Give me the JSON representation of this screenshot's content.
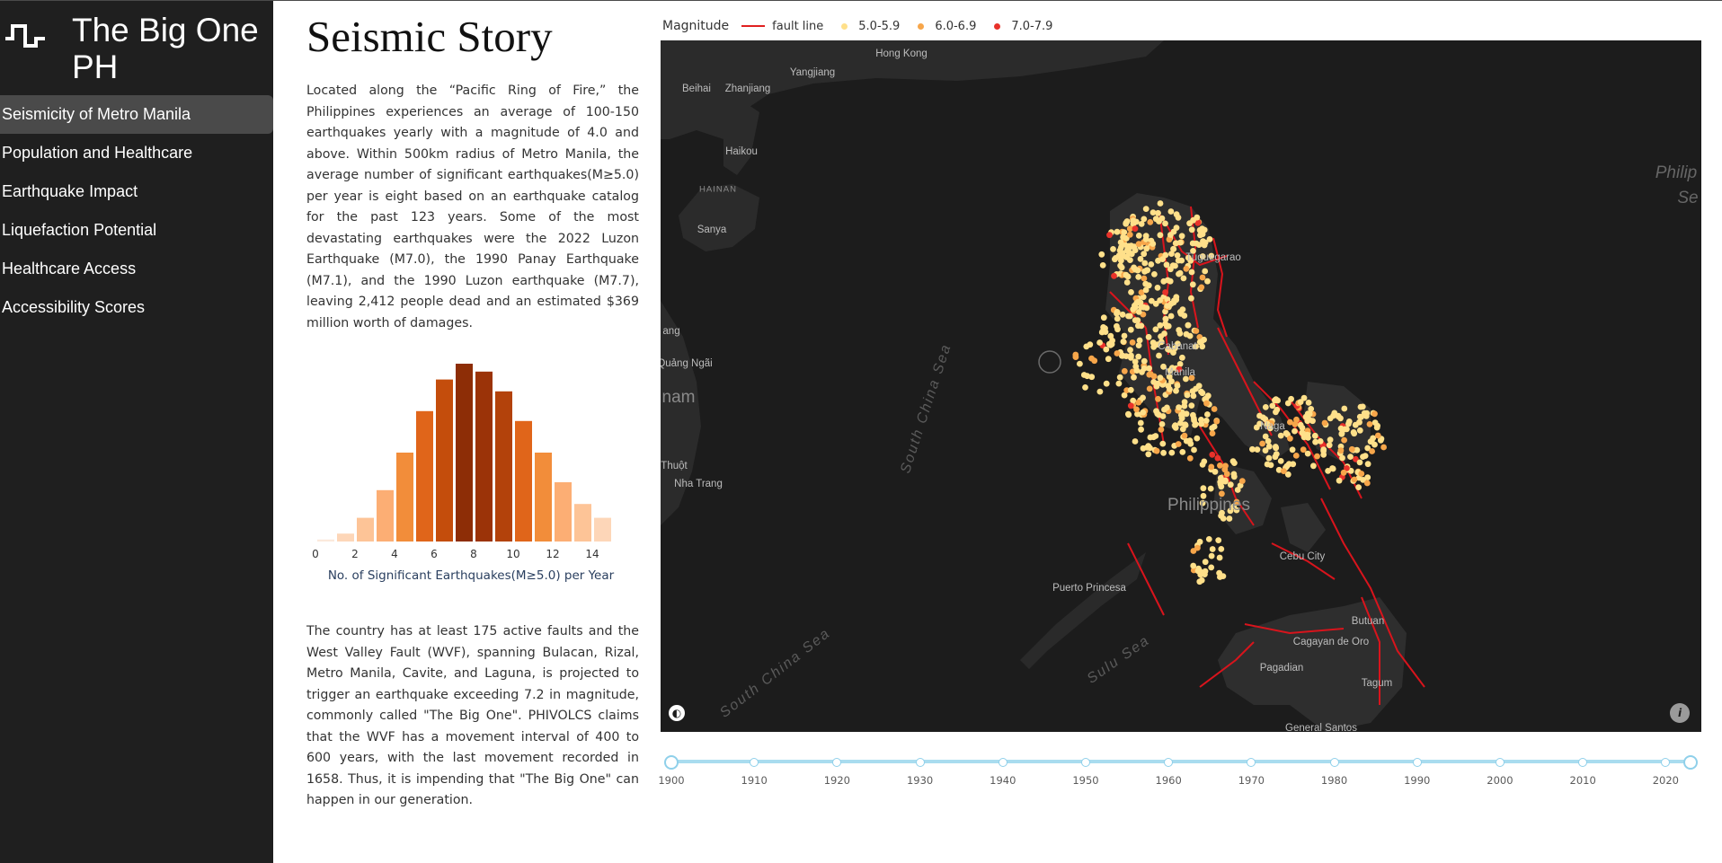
{
  "app": {
    "title": "The Big One PH",
    "nav": [
      {
        "label": "Seismicity of Metro Manila",
        "active": true
      },
      {
        "label": "Population and Healthcare"
      },
      {
        "label": "Earthquake Impact"
      },
      {
        "label": "Liquefaction Potential"
      },
      {
        "label": "Healthcare Access"
      },
      {
        "label": "Accessibility Scores"
      }
    ]
  },
  "story": {
    "title": "Seismic Story",
    "paragraph1": "Located along the “Pacific Ring of Fire,” the Philippines experiences an average of 100-150 earthquakes yearly with a magnitude of 4.0 and above. Within 500km radius of Metro Manila, the average number of significant earthquakes(M≥5.0) per year is eight based on an earthquake catalog for the past 123 years. Some of the most devastating earthquakes were the 2022 Luzon Earthquake (M7.0), the 1990 Panay Earthquake (M7.1), and the 1990 Luzon earthquake (M7.7), leaving 2,412 people dead and an estimated $369 million worth of damages.",
    "paragraph2": "The country has at least 175 active faults and the West Valley Fault (WVF), spanning Bulacan, Rizal, Metro Manila, Cavite, and Laguna, is projected to trigger an earthquake exceeding 7.2 in magnitude, commonly called \"The Big One\". PHIVOLCS claims that the WVF has a movement interval of 400 to 600 years, with the last movement recorded in 1658. Thus, it is impending that \"The Big One\" can happen in our generation."
  },
  "chart_data": {
    "type": "bar",
    "xlabel": "No. of Significant Earthquakes(M≥5.0) per Year",
    "x_ticks": [
      0,
      2,
      4,
      6,
      8,
      10,
      12,
      14
    ],
    "bins": [
      1,
      2,
      3,
      4,
      5,
      6,
      7,
      8,
      9,
      10,
      11,
      12,
      13,
      14,
      15
    ],
    "values": [
      1,
      4,
      12,
      26,
      45,
      66,
      82,
      90,
      86,
      76,
      61,
      45,
      30,
      19,
      12
    ],
    "colors": [
      "#fbe9dc",
      "#fdd6b8",
      "#fdc497",
      "#fcae74",
      "#f28d3a",
      "#e0651a",
      "#c44d0c",
      "#8d2d06",
      "#9b3308",
      "#b3420b",
      "#e0651a",
      "#f28d3a",
      "#fcae74",
      "#fdc497",
      "#fdd6b8"
    ]
  },
  "map": {
    "legend": {
      "title": "Magnitude",
      "items": [
        {
          "label": "fault line",
          "kind": "line",
          "color": "#e02020"
        },
        {
          "label": "5.0-5.9",
          "kind": "dot",
          "color": "#ffe08a"
        },
        {
          "label": "6.0-6.9",
          "kind": "dot",
          "color": "#f7a64a"
        },
        {
          "label": "7.0-7.9",
          "kind": "dot",
          "color": "#e8322a"
        }
      ]
    },
    "labels": {
      "hongkong": "Hong Kong",
      "yangjiang": "Yangjiang",
      "beihai": "Beihai",
      "zhanjiang": "Zhanjiang",
      "haikou": "Haikou",
      "hainan": "HAINAN",
      "sanya": "Sanya",
      "quangngai": "Quảng Ngãi",
      "nam": "nam",
      "ang": "ang",
      "thuot": "Thuột",
      "nhatrang": "Nha Trang",
      "scs1": "South China Sea",
      "scs2": "South China Sea",
      "sulu": "Sulu Sea",
      "philippines": "Philippines",
      "philip_sea": "Philip",
      "philip_sea2": "Se",
      "manila": "Manila",
      "tuguegarao": "Tuguegarao",
      "cabanatuan": "Cabanat",
      "naga": "Naga",
      "cebu": "Cebu City",
      "puerto": "Puerto Princesa",
      "butuan": "Butuan",
      "cagayan": "Cagayan de Oro",
      "pagadian": "Pagadian",
      "tagum": "Tagum",
      "gensan": "General Santos"
    }
  },
  "timeline": {
    "years": [
      "1900",
      "1910",
      "1920",
      "1930",
      "1940",
      "1950",
      "1960",
      "1970",
      "1980",
      "1990",
      "2000",
      "2010",
      "2020"
    ],
    "range": [
      1900,
      2023
    ]
  }
}
